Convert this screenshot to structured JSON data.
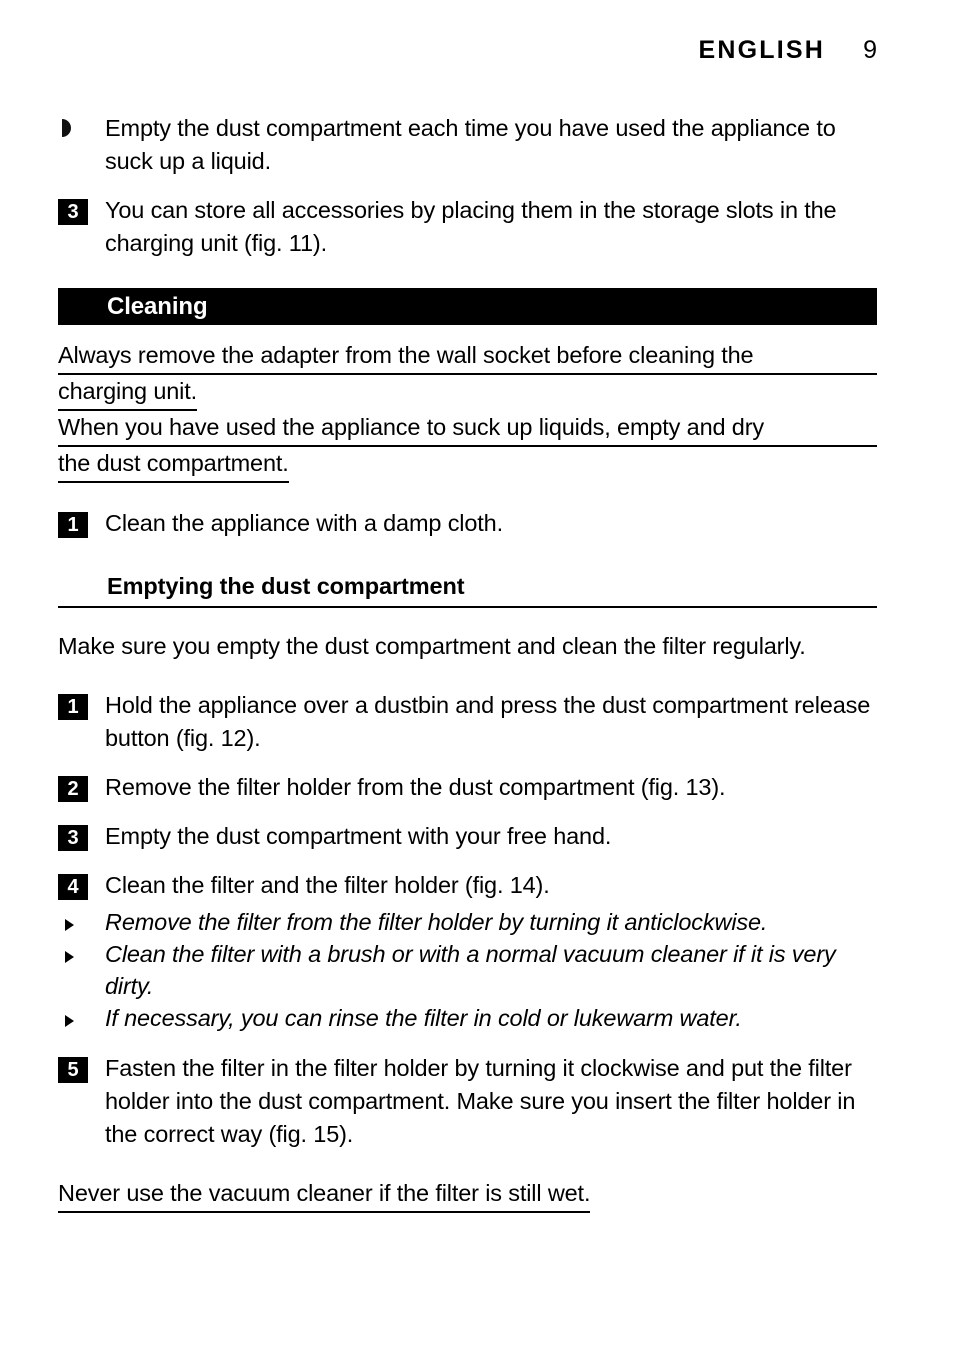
{
  "header": {
    "language": "ENGLISH",
    "page_number": "9"
  },
  "body": {
    "intro_bullet": "Empty the dust compartment each time you have used the appliance to suck up a liquid.",
    "step_three_storage": {
      "number": "3",
      "text": "You can store all accessories by placing them in the storage slots in the charging unit (fig. 11)."
    },
    "cleaning_section": {
      "title": "Cleaning",
      "warning_line_1a": "Always remove the adapter from the wall socket before cleaning the",
      "warning_line_1b": "charging unit.",
      "warning_line_2a": "When you have used the appliance to suck up liquids, empty and dry",
      "warning_line_2b": "the dust compartment.",
      "step_one": {
        "number": "1",
        "text": "Clean the appliance with a damp cloth."
      }
    },
    "emptying_section": {
      "title": "Emptying the dust compartment",
      "intro": "Make sure you empty the dust compartment and clean the filter regularly.",
      "steps": [
        {
          "number": "1",
          "text": "Hold the appliance over a dustbin and press the dust compartment release button (fig. 12)."
        },
        {
          "number": "2",
          "text": "Remove the filter holder from the dust compartment (fig. 13)."
        },
        {
          "number": "3",
          "text": "Empty the dust compartment with your free hand."
        },
        {
          "number": "4",
          "text": "Clean the filter and the filter holder (fig. 14)."
        }
      ],
      "sub_bullets": [
        "Remove the filter from the filter holder by turning it anticlockwise.",
        "Clean the filter with a brush or with a normal vacuum cleaner if it is very dirty.",
        "If necessary, you can rinse the filter in cold or lukewarm water."
      ],
      "step_five": {
        "number": "5",
        "text": "Fasten the filter in the filter holder by turning it clockwise and put the filter holder into the dust compartment. Make sure you insert the filter holder in the correct way (fig. 15)."
      },
      "final_warning": "Never use the vacuum cleaner if the filter is still wet."
    }
  }
}
